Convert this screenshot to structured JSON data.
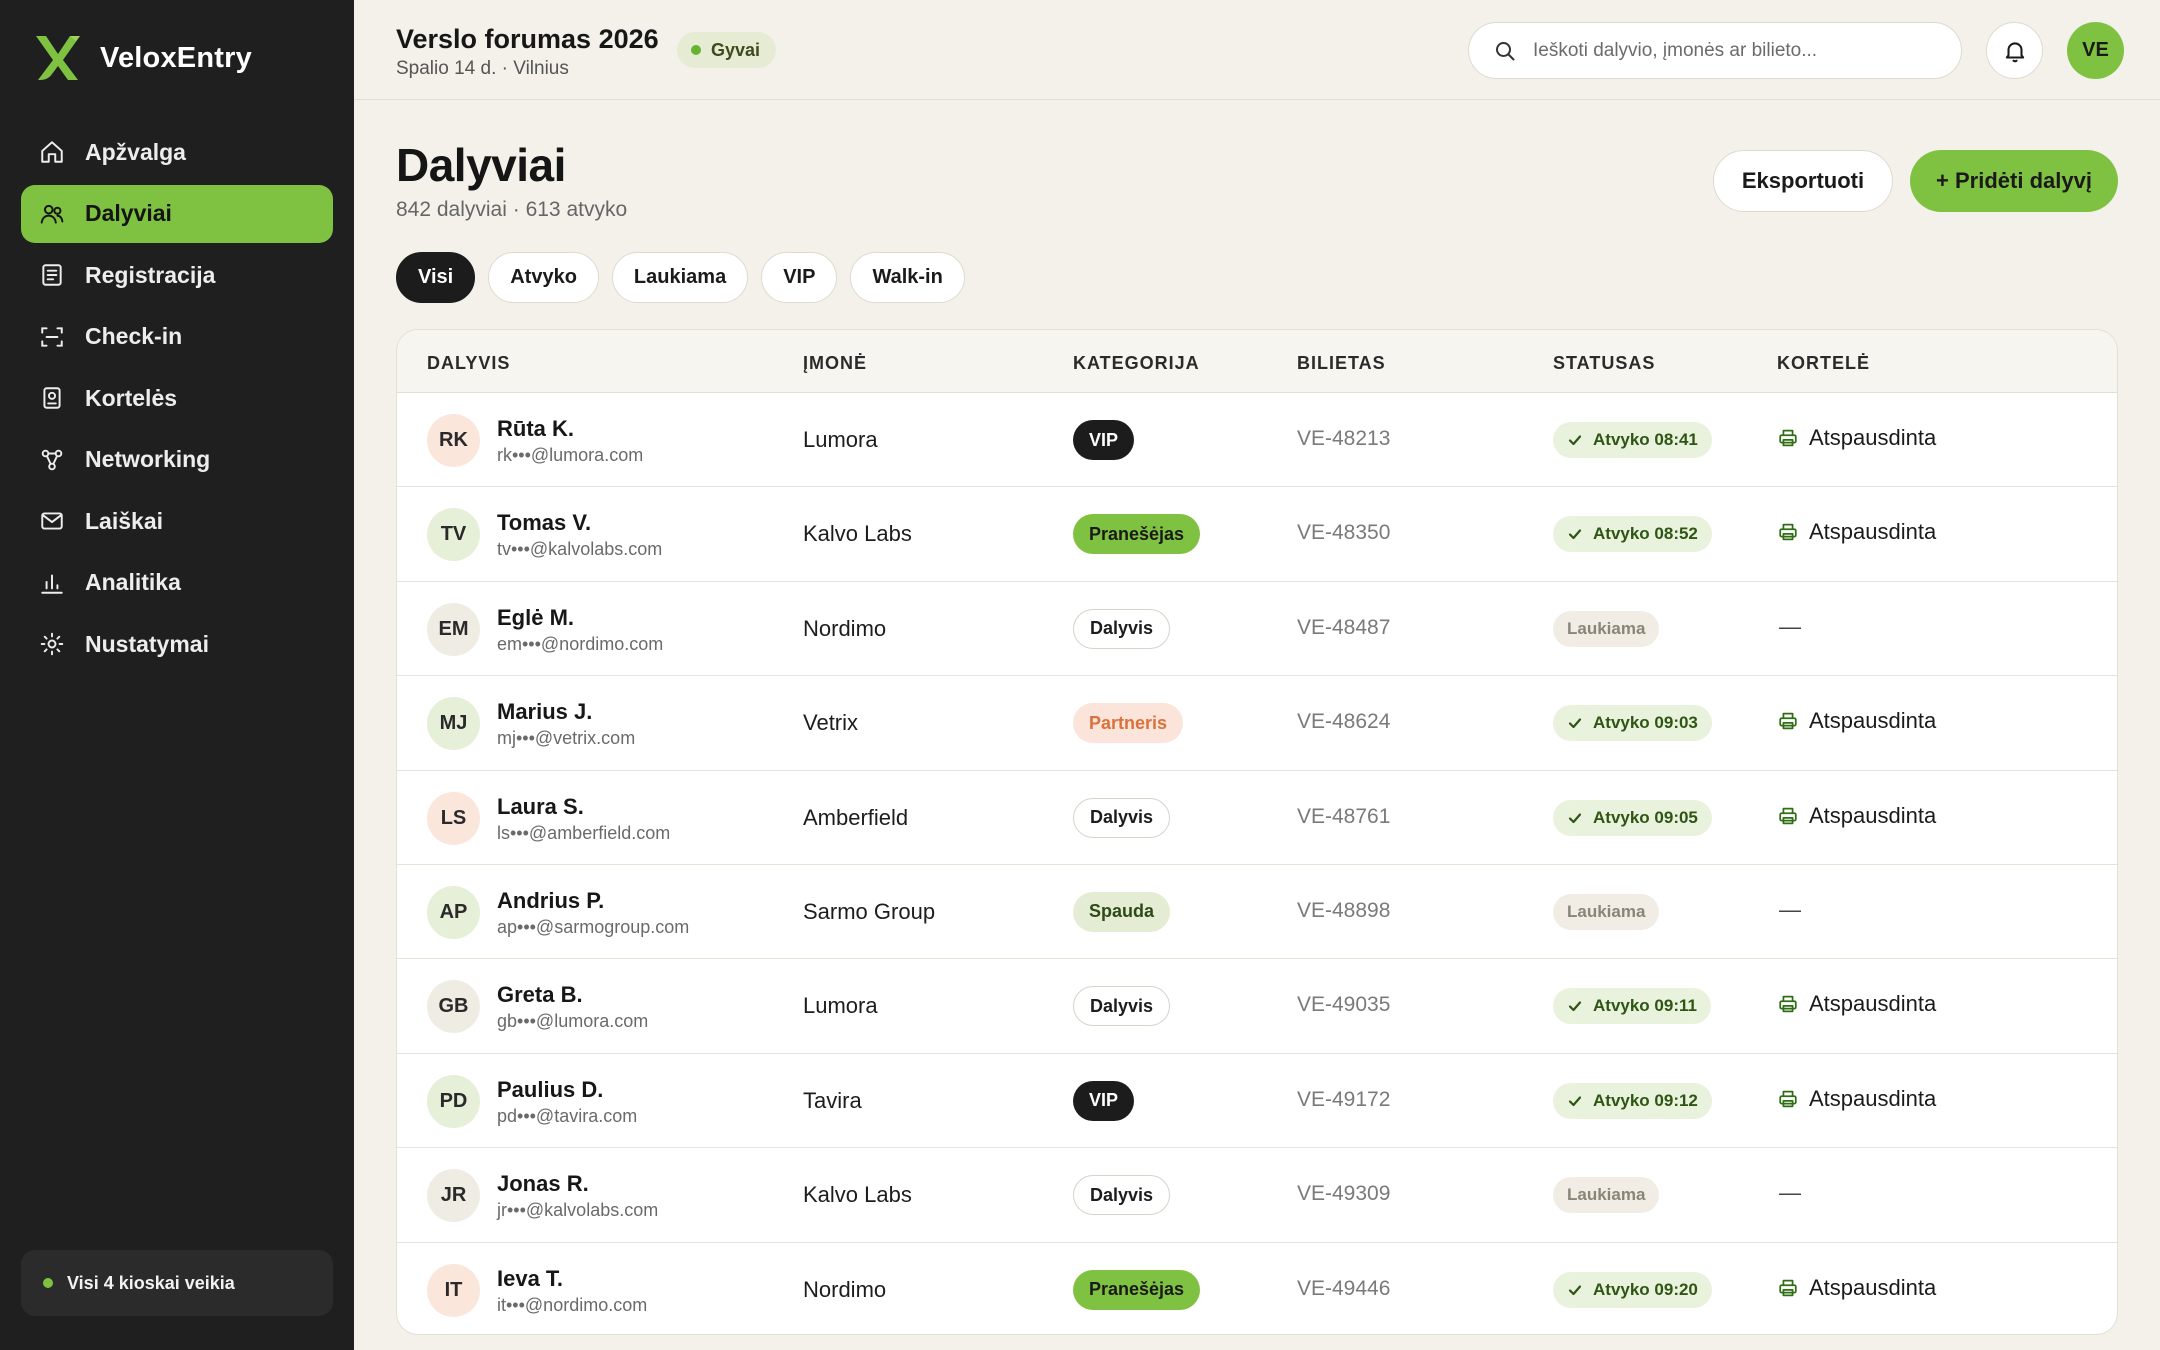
{
  "app": {
    "name": "VeloxEntry"
  },
  "sidebar": {
    "items": [
      {
        "label": "Apžvalga",
        "icon": "home-icon",
        "active": false
      },
      {
        "label": "Dalyviai",
        "icon": "users-icon",
        "active": true
      },
      {
        "label": "Registracija",
        "icon": "form-icon",
        "active": false
      },
      {
        "label": "Check-in",
        "icon": "scan-icon",
        "active": false
      },
      {
        "label": "Kortelės",
        "icon": "badge-icon",
        "active": false
      },
      {
        "label": "Networking",
        "icon": "network-icon",
        "active": false
      },
      {
        "label": "Laiškai",
        "icon": "mail-icon",
        "active": false
      },
      {
        "label": "Analitika",
        "icon": "chart-icon",
        "active": false
      },
      {
        "label": "Nustatymai",
        "icon": "settings-icon",
        "active": false
      }
    ],
    "kiosk_status": "Visi 4 kioskai veikia"
  },
  "header": {
    "event_title": "Verslo forumas 2026",
    "event_subtitle": "Spalio 14 d. · Vilnius",
    "live_label": "Gyvai",
    "search_placeholder": "Ieškoti dalyvio, įmonės ar bilieto...",
    "user_initials": "VE"
  },
  "page": {
    "title": "Dalyviai",
    "subtitle": "842 dalyviai · 613 atvyko",
    "export_label": "Eksportuoti",
    "add_label": "+ Pridėti dalyvį"
  },
  "filters": [
    {
      "label": "Visi",
      "active": true
    },
    {
      "label": "Atvyko",
      "active": false
    },
    {
      "label": "Laukiama",
      "active": false
    },
    {
      "label": "VIP",
      "active": false
    },
    {
      "label": "Walk-in",
      "active": false
    }
  ],
  "table": {
    "columns": {
      "participant": "DALYVIS",
      "company": "ĮMONĖ",
      "category": "KATEGORIJA",
      "ticket": "BILIETAS",
      "status": "STATUSAS",
      "card": "KORTELĖ"
    },
    "rows": [
      {
        "initials": "RK",
        "avatar_tone": "peach",
        "name": "Rūta K.",
        "email": "rk•••@lumora.com",
        "company": "Lumora",
        "category": "VIP",
        "category_style": "vip",
        "ticket": "VE-48213",
        "status": "Atvyko 08:41",
        "arrived": true,
        "card": "Atspausdinta"
      },
      {
        "initials": "TV",
        "avatar_tone": "green",
        "name": "Tomas V.",
        "email": "tv•••@kalvolabs.com",
        "company": "Kalvo Labs",
        "category": "Pranešėjas",
        "category_style": "speaker",
        "ticket": "VE-48350",
        "status": "Atvyko 08:52",
        "arrived": true,
        "card": "Atspausdinta"
      },
      {
        "initials": "EM",
        "avatar_tone": "beige",
        "name": "Eglė M.",
        "email": "em•••@nordimo.com",
        "company": "Nordimo",
        "category": "Dalyvis",
        "category_style": "attendee",
        "ticket": "VE-48487",
        "status": "Laukiama",
        "arrived": false,
        "card": "—"
      },
      {
        "initials": "MJ",
        "avatar_tone": "green",
        "name": "Marius J.",
        "email": "mj•••@vetrix.com",
        "company": "Vetrix",
        "category": "Partneris",
        "category_style": "partner",
        "ticket": "VE-48624",
        "status": "Atvyko 09:03",
        "arrived": true,
        "card": "Atspausdinta"
      },
      {
        "initials": "LS",
        "avatar_tone": "peach",
        "name": "Laura S.",
        "email": "ls•••@amberfield.com",
        "company": "Amberfield",
        "category": "Dalyvis",
        "category_style": "attendee",
        "ticket": "VE-48761",
        "status": "Atvyko 09:05",
        "arrived": true,
        "card": "Atspausdinta"
      },
      {
        "initials": "AP",
        "avatar_tone": "green",
        "name": "Andrius P.",
        "email": "ap•••@sarmogroup.com",
        "company": "Sarmo Group",
        "category": "Spauda",
        "category_style": "press",
        "ticket": "VE-48898",
        "status": "Laukiama",
        "arrived": false,
        "card": "—"
      },
      {
        "initials": "GB",
        "avatar_tone": "beige",
        "name": "Greta B.",
        "email": "gb•••@lumora.com",
        "company": "Lumora",
        "category": "Dalyvis",
        "category_style": "attendee",
        "ticket": "VE-49035",
        "status": "Atvyko 09:11",
        "arrived": true,
        "card": "Atspausdinta"
      },
      {
        "initials": "PD",
        "avatar_tone": "green",
        "name": "Paulius D.",
        "email": "pd•••@tavira.com",
        "company": "Tavira",
        "category": "VIP",
        "category_style": "vip",
        "ticket": "VE-49172",
        "status": "Atvyko 09:12",
        "arrived": true,
        "card": "Atspausdinta"
      },
      {
        "initials": "JR",
        "avatar_tone": "beige",
        "name": "Jonas R.",
        "email": "jr•••@kalvolabs.com",
        "company": "Kalvo Labs",
        "category": "Dalyvis",
        "category_style": "attendee",
        "ticket": "VE-49309",
        "status": "Laukiama",
        "arrived": false,
        "card": "—"
      },
      {
        "initials": "IT",
        "avatar_tone": "peach",
        "name": "Ieva T.",
        "email": "it•••@nordimo.com",
        "company": "Nordimo",
        "category": "Pranešėjas",
        "category_style": "speaker",
        "ticket": "VE-49446",
        "status": "Atvyko 09:20",
        "arrived": true,
        "card": "Atspausdinta"
      }
    ]
  },
  "colors": {
    "accent": "#7fc241",
    "sidebar_bg": "#1f1f1f",
    "page_bg": "#f3f1ea",
    "status_arrived_bg": "#e9f2dc",
    "status_arrived_text": "#2f5514",
    "status_waiting_bg": "#f1ede4",
    "status_waiting_text": "#8a8578"
  }
}
